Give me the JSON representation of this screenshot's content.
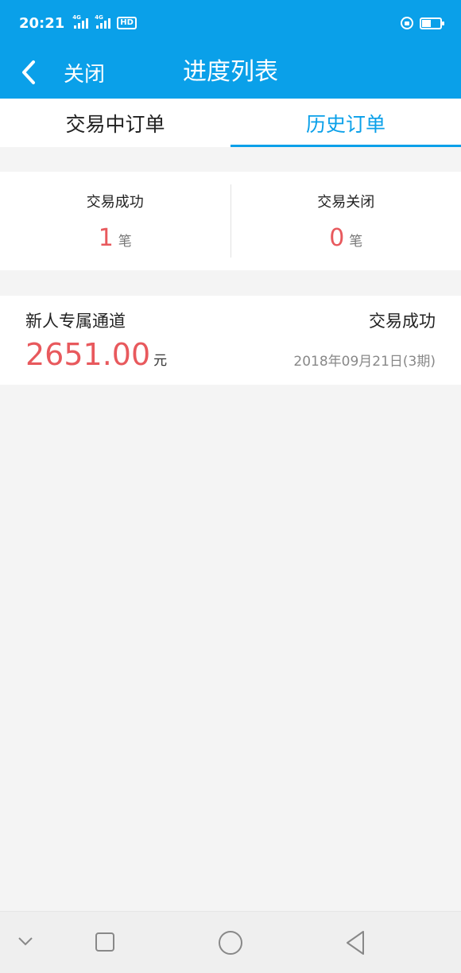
{
  "status_bar": {
    "time": "20:21",
    "network_1": "4G",
    "network_2": "4G",
    "hd_label": "HD",
    "battery_level": 0.5
  },
  "navbar": {
    "close_label": "关闭",
    "title": "进度列表"
  },
  "tabs": [
    {
      "label": "交易中订单",
      "active": false
    },
    {
      "label": "历史订单",
      "active": true
    }
  ],
  "summary": {
    "success": {
      "label": "交易成功",
      "count": "1",
      "unit": "笔"
    },
    "closed": {
      "label": "交易关闭",
      "count": "0",
      "unit": "笔"
    }
  },
  "orders": [
    {
      "name": "新人专属通道",
      "status": "交易成功",
      "amount": "2651.00",
      "currency": "元",
      "date": "2018年09月21日(3期)"
    }
  ],
  "colors": {
    "brand": "#0aa0e9",
    "amount_red": "#e8595d",
    "background": "#f4f4f4"
  }
}
